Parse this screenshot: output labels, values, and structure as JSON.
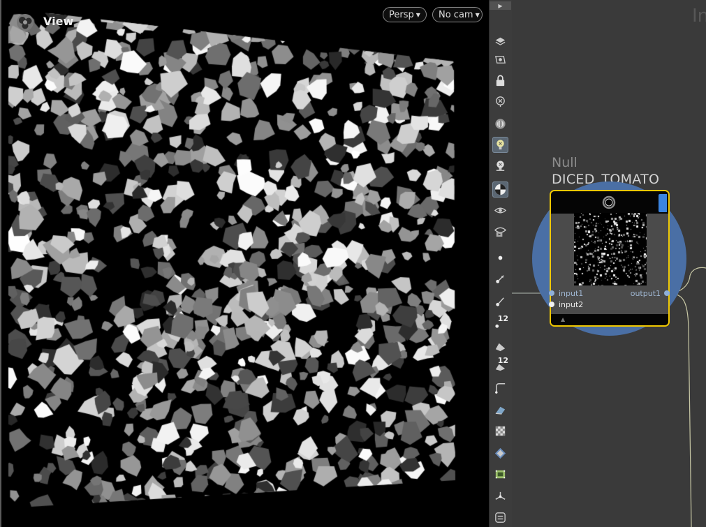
{
  "viewport": {
    "title": "View",
    "persp_label": "Persp",
    "camera_label": "No cam"
  },
  "toolbar": {
    "tools": [
      {
        "name": "display-options-icon",
        "active": false
      },
      {
        "name": "view-display-icon",
        "active": false
      },
      {
        "name": "lock-camera-icon",
        "active": false
      },
      {
        "name": "close-view-icon",
        "active": false
      },
      {
        "name": "ghost-icon",
        "active": false
      },
      {
        "name": "headlight-icon",
        "active": true
      },
      {
        "name": "light-icon",
        "active": false
      },
      {
        "name": "shading-icon",
        "active": true
      },
      {
        "name": "template-icon",
        "active": false
      },
      {
        "name": "visualizer-icon",
        "active": false
      },
      {
        "name": "point-icon",
        "active": false
      },
      {
        "name": "point-normal-icon",
        "active": false
      },
      {
        "name": "point-vector-icon",
        "active": false
      },
      {
        "name": "point-number-icon",
        "active": false,
        "num": "12"
      },
      {
        "name": "primitive-icon",
        "active": false
      },
      {
        "name": "primitive-number-icon",
        "active": false,
        "num": "12"
      },
      {
        "name": "edge-icon",
        "active": false
      },
      {
        "name": "uv-icon",
        "active": false
      },
      {
        "name": "checker-icon",
        "active": false
      },
      {
        "name": "vertex-icon",
        "active": false
      },
      {
        "name": "bounding-box-icon",
        "active": false
      },
      {
        "name": "handle-icon",
        "active": false
      },
      {
        "name": "snapshot-icon",
        "active": false
      }
    ]
  },
  "network": {
    "label": "In",
    "node": {
      "type": "Null",
      "name": "DICED_TOMATO",
      "ports": {
        "input1": "input1",
        "input2": "input2",
        "output1": "output1"
      },
      "colors": {
        "circle": "#4a6fa5",
        "selected_border": "#f0c800",
        "flag": "#3a84e0"
      }
    }
  }
}
